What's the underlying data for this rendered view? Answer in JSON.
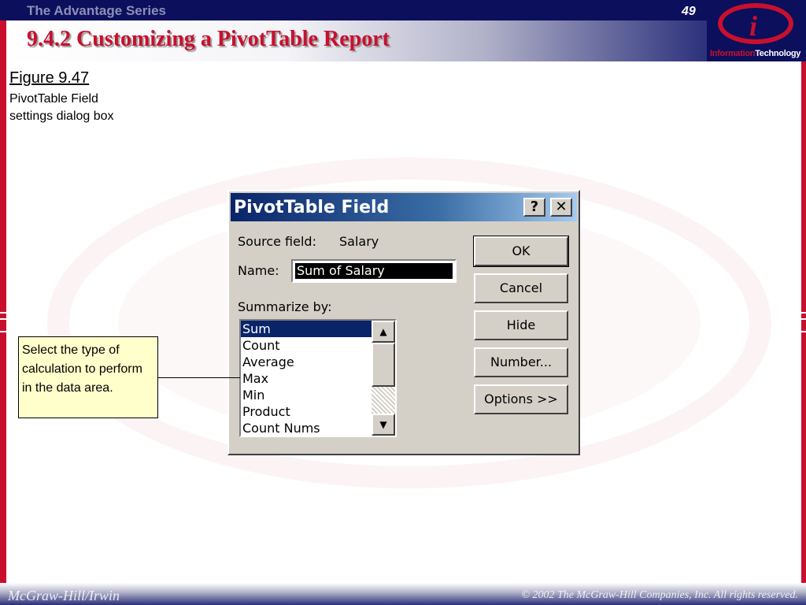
{
  "header": {
    "series_title": "The Advantage Series",
    "slide_number": "49",
    "slide_title": "9.4.2 Customizing a PivotTable Report"
  },
  "logo": {
    "letter": "i",
    "word1": "Information",
    "word2": "Technology"
  },
  "figure": {
    "label": "Figure 9.47",
    "caption": "PivotTable Field settings dialog box"
  },
  "dialog": {
    "title": "PivotTable Field",
    "help_button": "?",
    "close_button": "✕",
    "source_field_label": "Source field:",
    "source_field_value": "Salary",
    "name_label": "Name:",
    "name_value": "Sum of Salary",
    "summarize_label": "Summarize by:",
    "summarize_options": [
      "Sum",
      "Count",
      "Average",
      "Max",
      "Min",
      "Product",
      "Count Nums"
    ],
    "selected_option": "Sum",
    "buttons": {
      "ok": "OK",
      "cancel": "Cancel",
      "hide": "Hide",
      "number": "Number...",
      "options": "Options >>"
    }
  },
  "callout": {
    "text": "Select the type of calculation to perform in the data area."
  },
  "footer": {
    "left": "McGraw-Hill/Irwin",
    "right": "© 2002  The McGraw-Hill Companies, Inc. All rights reserved."
  },
  "colors": {
    "accent_red": "#c8102e",
    "navy": "#0b0f5c",
    "dialog_face": "#d4d0c8",
    "selection": "#0a246a",
    "callout_bg": "#ffffcc"
  }
}
